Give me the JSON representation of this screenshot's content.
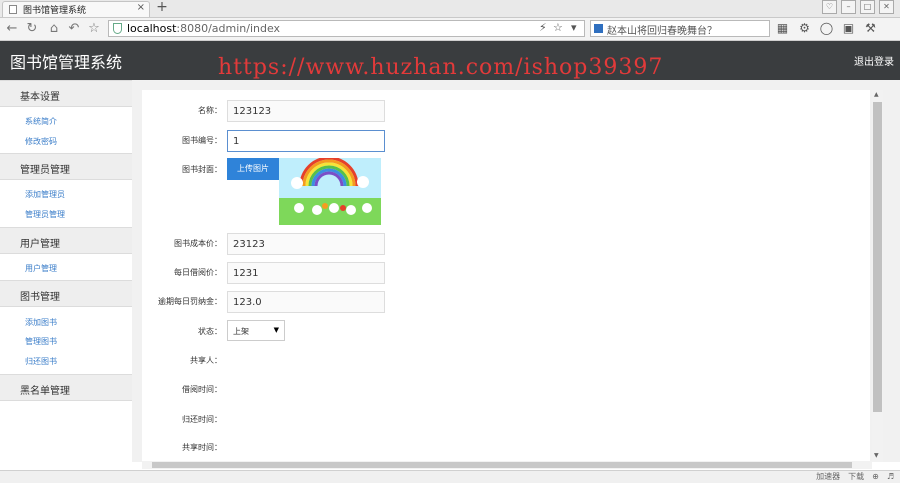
{
  "browser": {
    "tab_title": "图书馆管理系统",
    "tab_close": "×",
    "new_tab": "+",
    "url_host": "localhost",
    "url_rest": ":8080/admin/index",
    "search_text": "赵本山将回归春晚舞台？",
    "status_items": [
      "加速器",
      "下载"
    ]
  },
  "header": {
    "brand": "图书馆管理系统",
    "logout": "退出登录",
    "watermark": "https://www.huzhan.com/ishop39397"
  },
  "sidebar": {
    "sections": [
      {
        "title": "基本设置",
        "items": [
          "系统简介",
          "修改密码"
        ]
      },
      {
        "title": "管理员管理",
        "items": [
          "添加管理员",
          "管理员管理"
        ]
      },
      {
        "title": "用户管理",
        "items": [
          "用户管理"
        ]
      },
      {
        "title": "图书管理",
        "items": [
          "添加图书",
          "管理图书",
          "归还图书"
        ]
      },
      {
        "title": "黑名单管理",
        "items": []
      }
    ]
  },
  "form": {
    "name_label": "名称：",
    "name_value": "123123",
    "code_label": "图书编号：",
    "code_value": "1",
    "cover_label": "图书封面：",
    "upload_label": "上传图片",
    "cost_label": "图书成本价：",
    "cost_value": "23123",
    "daily_label": "每日借阅价：",
    "daily_value": "1231",
    "fee_label": "逾期每日罚纳金：",
    "fee_value": "123.0",
    "status_label": "状态：",
    "status_value": "上架",
    "sharer_label": "共享人：",
    "borrow_time_label": "借阅时间：",
    "return_time_label": "归还时间：",
    "share_time_label": "共享时间："
  },
  "colors": {
    "header_bg": "#3a3d3f",
    "upload_btn": "#2f83d9",
    "link": "#3a7dc9",
    "watermark": "#e23a3a"
  }
}
